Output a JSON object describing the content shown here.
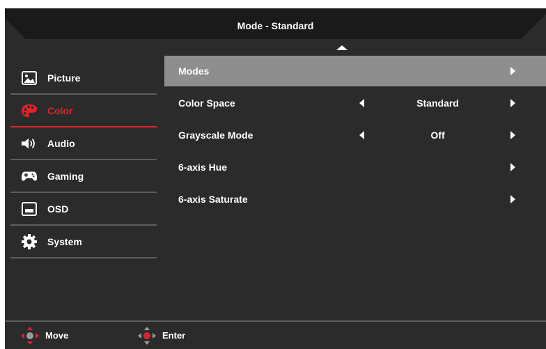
{
  "header": {
    "title": "Mode - Standard"
  },
  "sidebar": {
    "items": [
      {
        "label": "Picture",
        "icon": "picture-icon"
      },
      {
        "label": "Color",
        "icon": "palette-icon",
        "active": true
      },
      {
        "label": "Audio",
        "icon": "speaker-icon"
      },
      {
        "label": "Gaming",
        "icon": "gamepad-icon"
      },
      {
        "label": "OSD",
        "icon": "osd-icon"
      },
      {
        "label": "System",
        "icon": "gear-icon"
      }
    ]
  },
  "main": {
    "rows": [
      {
        "label": "Modes",
        "value": "",
        "selected": true
      },
      {
        "label": "Color Space",
        "value": "Standard"
      },
      {
        "label": "Grayscale Mode",
        "value": "Off"
      },
      {
        "label": "6-axis Hue",
        "value": ""
      },
      {
        "label": "6-axis Saturate",
        "value": ""
      }
    ]
  },
  "footer": {
    "move_label": "Move",
    "enter_label": "Enter"
  },
  "colors": {
    "accent": "#e0232a",
    "panel": "#2b2b2b",
    "header": "#1a1a1a",
    "selected": "#8e8e8e"
  }
}
